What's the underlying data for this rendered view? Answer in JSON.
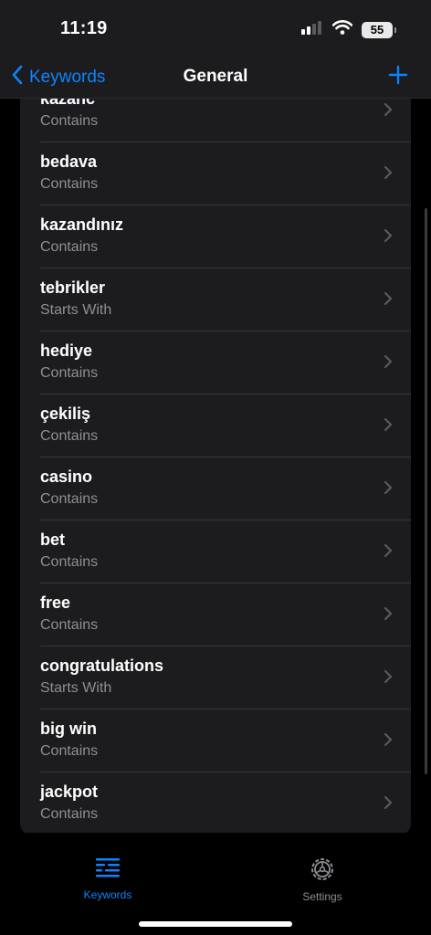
{
  "status_bar": {
    "time": "11:19",
    "battery": "55"
  },
  "nav": {
    "back_label": "Keywords",
    "title": "General"
  },
  "keywords": [
    {
      "word": "kazanc",
      "match": "Contains"
    },
    {
      "word": "bedava",
      "match": "Contains"
    },
    {
      "word": "kazandınız",
      "match": "Contains"
    },
    {
      "word": "tebrikler",
      "match": "Starts With"
    },
    {
      "word": "hediye",
      "match": "Contains"
    },
    {
      "word": "çekiliş",
      "match": "Contains"
    },
    {
      "word": "casino",
      "match": "Contains"
    },
    {
      "word": "bet",
      "match": "Contains"
    },
    {
      "word": "free",
      "match": "Contains"
    },
    {
      "word": "congratulations",
      "match": "Starts With"
    },
    {
      "word": "big win",
      "match": "Contains"
    },
    {
      "word": "jackpot",
      "match": "Contains"
    }
  ],
  "tab_bar": {
    "tabs": [
      {
        "label": "Keywords",
        "icon": "list-icon",
        "active": true
      },
      {
        "label": "Settings",
        "icon": "gear-icon",
        "active": false
      }
    ]
  },
  "colors": {
    "accent": "#0a84ff",
    "background": "#000000",
    "card": "#1c1c1e",
    "secondary_text": "#8e8e93"
  }
}
